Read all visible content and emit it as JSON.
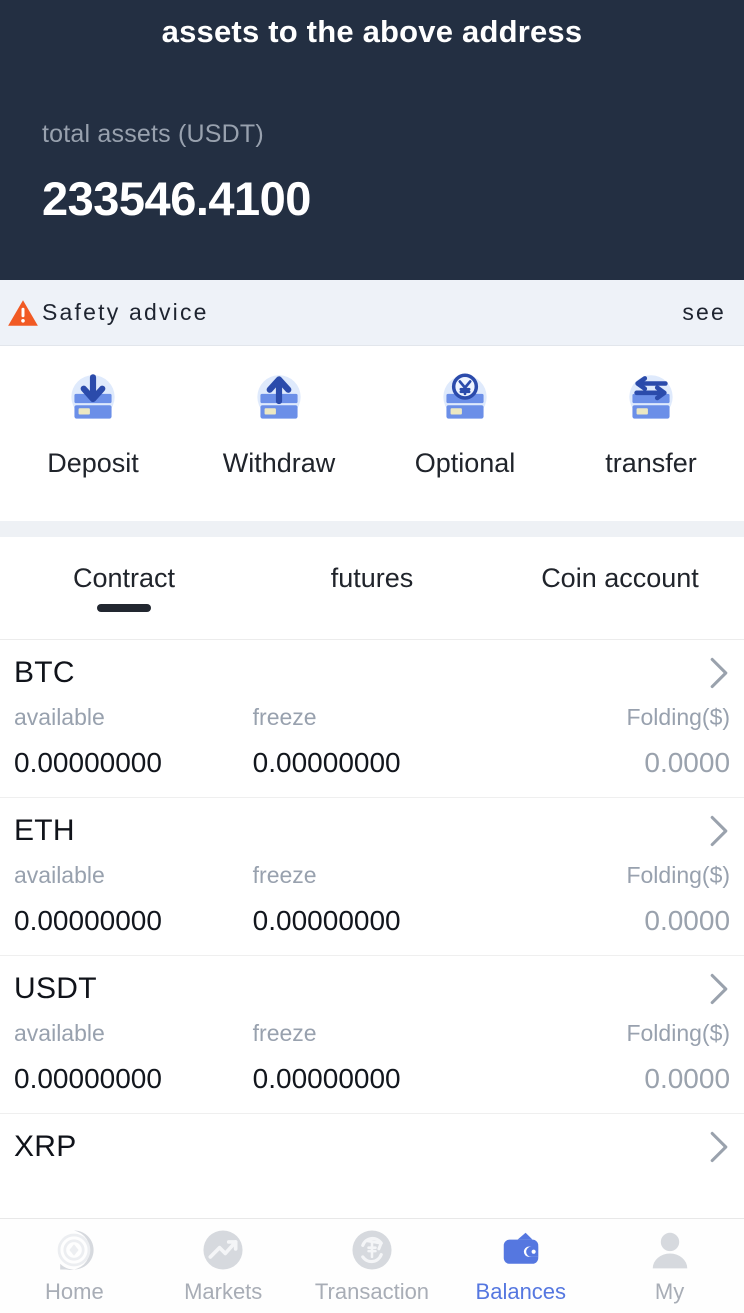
{
  "header": {
    "title": "assets to the above address",
    "total_label": "total assets (USDT)",
    "total_value": "233546.4100",
    "bg_color": "#232f42"
  },
  "safety": {
    "icon": "warning-triangle-icon",
    "text": "Safety advice",
    "see_label": "see",
    "icon_color": "#f15a24"
  },
  "actions": [
    {
      "label": "Deposit",
      "icon": "card-download-icon"
    },
    {
      "label": "Withdraw",
      "icon": "card-upload-icon"
    },
    {
      "label": "Optional",
      "icon": "card-currency-icon"
    },
    {
      "label": "transfer",
      "icon": "card-exchange-icon"
    }
  ],
  "tabs": [
    {
      "label": "Contract",
      "active": true
    },
    {
      "label": "futures",
      "active": false
    },
    {
      "label": "Coin account",
      "active": false
    }
  ],
  "columns": {
    "available": "available",
    "freeze": "freeze",
    "folding": "Folding($)"
  },
  "coins": [
    {
      "symbol": "BTC",
      "available": "0.00000000",
      "freeze": "0.00000000",
      "folding": "0.0000"
    },
    {
      "symbol": "ETH",
      "available": "0.00000000",
      "freeze": "0.00000000",
      "folding": "0.0000"
    },
    {
      "symbol": "USDT",
      "available": "0.00000000",
      "freeze": "0.00000000",
      "folding": "0.0000"
    },
    {
      "symbol": "XRP",
      "available": "",
      "freeze": "",
      "folding": ""
    }
  ],
  "bottom_nav": {
    "accent_color": "#5577e0",
    "items": [
      {
        "label": "Home",
        "icon": "compass-icon",
        "active": false
      },
      {
        "label": "Markets",
        "icon": "trending-up-icon",
        "active": false
      },
      {
        "label": "Transaction",
        "icon": "exchange-icon",
        "active": false
      },
      {
        "label": "Balances",
        "icon": "wallet-icon",
        "active": true
      },
      {
        "label": "My",
        "icon": "person-icon",
        "active": false
      }
    ]
  }
}
